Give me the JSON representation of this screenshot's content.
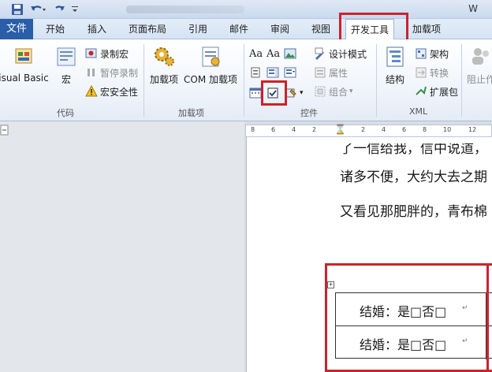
{
  "titlebar": {
    "icons": [
      "save-icon",
      "undo-icon",
      "redo-icon",
      "customize-qat-icon"
    ],
    "trailing_char": "W"
  },
  "tabs": {
    "file": "文件",
    "items": [
      "开始",
      "插入",
      "页面布局",
      "引用",
      "邮件",
      "审阅",
      "视图",
      "开发工具",
      "加载项"
    ],
    "active": "开发工具"
  },
  "ribbon": {
    "code_group": {
      "label": "代码",
      "visual_basic": "isual Basic",
      "macros": "宏",
      "record_macro": "录制宏",
      "pause_recording": "暂停录制",
      "macro_security": "宏安全性"
    },
    "addins_group": {
      "label": "加载项",
      "addins": "加载项",
      "com_addins": "COM 加载项"
    },
    "controls_group": {
      "label": "控件",
      "design_mode": "设计模式",
      "properties": "属性",
      "group": "组合"
    },
    "xml_group": {
      "label": "XML",
      "structure": "结构",
      "schema": "架构",
      "transform": "转换",
      "expansion_pack": "扩展包"
    },
    "protect_group": {
      "block_authors": "阻止作"
    }
  },
  "ruler": {
    "ticks": [
      "8",
      "6",
      "4",
      "2",
      "2",
      "4",
      "6",
      "8",
      "10",
      "12"
    ]
  },
  "document": {
    "lines": [
      "了一信给我，信中说道，",
      "诸多不便，大约大去之期",
      "又看见那肥胖的，青布棉"
    ],
    "table_rows": [
      "结婚：是□否□",
      "结婚：是□否□"
    ],
    "paragraph_mark": "↵"
  },
  "colors": {
    "highlight": "#d0212a",
    "file_tab": "#2a5ea8"
  }
}
